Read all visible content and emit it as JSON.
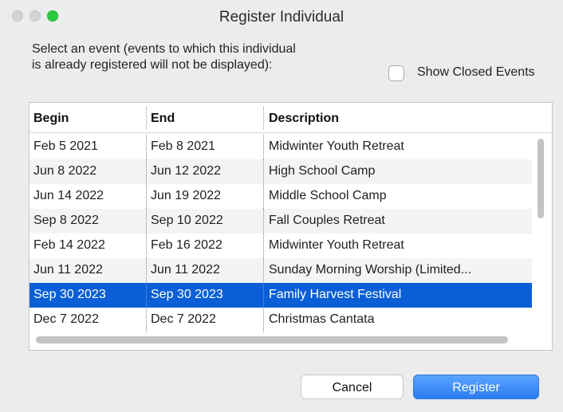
{
  "window": {
    "title": "Register Individual"
  },
  "prompt": {
    "line1": "Select an event (events to which this individual",
    "line2": "is already registered will not be displayed):"
  },
  "show_closed": {
    "label": "Show Closed Events",
    "checked": false
  },
  "table": {
    "headers": [
      "Begin",
      "End",
      "Description"
    ],
    "rows": [
      {
        "begin": "Feb 5 2021",
        "end": "Feb 8 2021",
        "description": "Midwinter Youth Retreat"
      },
      {
        "begin": "Jun 8 2022",
        "end": "Jun 12 2022",
        "description": "High School Camp"
      },
      {
        "begin": "Jun 14 2022",
        "end": "Jun 19 2022",
        "description": "Middle School Camp"
      },
      {
        "begin": "Sep 8 2022",
        "end": "Sep 10 2022",
        "description": "Fall Couples Retreat"
      },
      {
        "begin": "Feb 14 2022",
        "end": "Feb 16 2022",
        "description": "Midwinter Youth Retreat"
      },
      {
        "begin": "Jun 11 2022",
        "end": "Jun 11 2022",
        "description": "Sunday Morning Worship (Limited..."
      },
      {
        "begin": "Sep 30 2023",
        "end": "Sep 30 2023",
        "description": "Family Harvest Festival"
      },
      {
        "begin": "Dec 7 2022",
        "end": "Dec 7 2022",
        "description": "Christmas Cantata"
      }
    ],
    "selected_index": 6
  },
  "buttons": {
    "cancel": "Cancel",
    "register": "Register"
  },
  "colors": {
    "selection": "#0a5fd6",
    "primary_button": "#2b7cf2",
    "maximize_light": "#2ac940"
  }
}
